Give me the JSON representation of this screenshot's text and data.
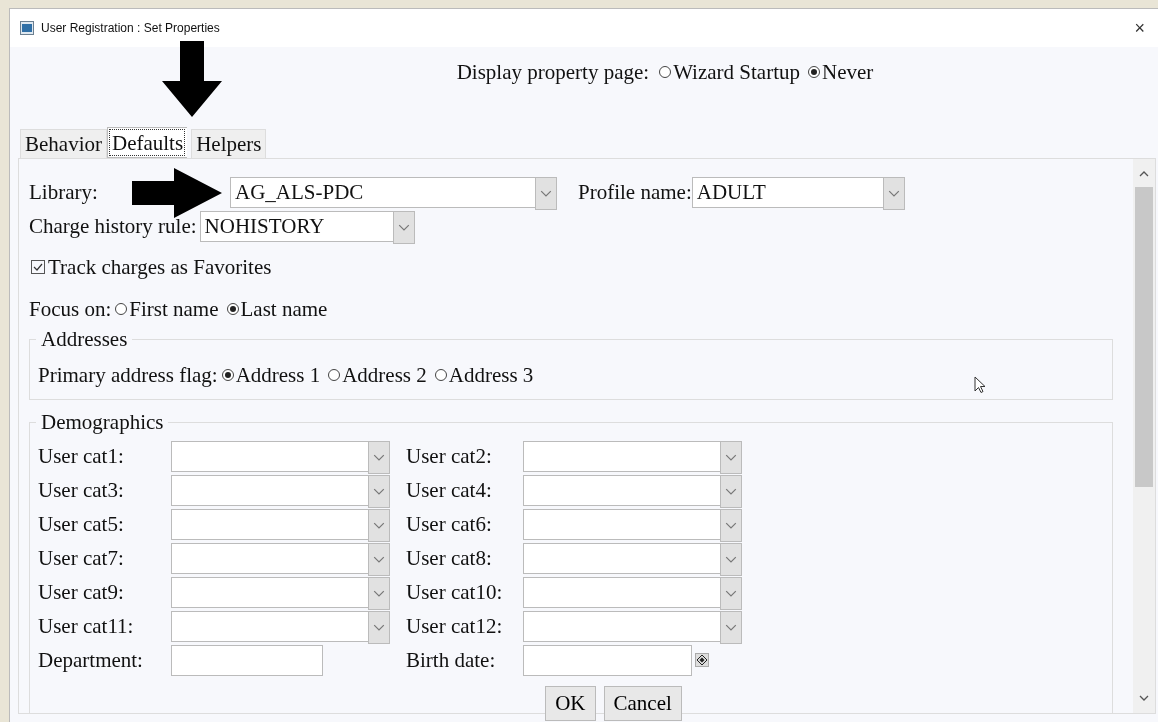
{
  "window": {
    "title": "User Registration : Set Properties",
    "close": "×"
  },
  "display_property_page": {
    "label": "Display property page:",
    "options": [
      {
        "label": "Wizard Startup",
        "selected": false
      },
      {
        "label": "Never",
        "selected": true
      }
    ]
  },
  "tabs": [
    {
      "label": "Behavior",
      "selected": false
    },
    {
      "label": "Defaults",
      "selected": true
    },
    {
      "label": "Helpers",
      "selected": false
    }
  ],
  "defaults": {
    "library": {
      "label": "Library:",
      "value": "AG_ALS-PDC"
    },
    "profile_name": {
      "label": "Profile name:",
      "value": "ADULT"
    },
    "charge_history_rule": {
      "label": "Charge history rule:",
      "value": "NOHISTORY"
    },
    "track_charges": {
      "label": "Track charges as Favorites",
      "checked": true
    },
    "focus_on": {
      "label": "Focus on:",
      "options": [
        {
          "label": "First name",
          "selected": false
        },
        {
          "label": "Last name",
          "selected": true
        }
      ]
    },
    "addresses": {
      "legend": "Addresses",
      "label": "Primary address flag:",
      "options": [
        {
          "label": "Address 1",
          "selected": true
        },
        {
          "label": "Address 2",
          "selected": false
        },
        {
          "label": "Address 3",
          "selected": false
        }
      ]
    },
    "demographics": {
      "legend": "Demographics",
      "fields": [
        {
          "label": "User cat1:",
          "kind": "select"
        },
        {
          "label": "User cat2:",
          "kind": "select"
        },
        {
          "label": "User cat3:",
          "kind": "select"
        },
        {
          "label": "User cat4:",
          "kind": "select"
        },
        {
          "label": "User cat5:",
          "kind": "select"
        },
        {
          "label": "User cat6:",
          "kind": "select"
        },
        {
          "label": "User cat7:",
          "kind": "select"
        },
        {
          "label": "User cat8:",
          "kind": "select"
        },
        {
          "label": "User cat9:",
          "kind": "select"
        },
        {
          "label": "User cat10:",
          "kind": "select"
        },
        {
          "label": "User cat11:",
          "kind": "select"
        },
        {
          "label": "User cat12:",
          "kind": "select"
        },
        {
          "label": "Department:",
          "kind": "text"
        },
        {
          "label": "Birth date:",
          "kind": "date"
        }
      ]
    }
  },
  "buttons": [
    "OK",
    "Cancel"
  ]
}
